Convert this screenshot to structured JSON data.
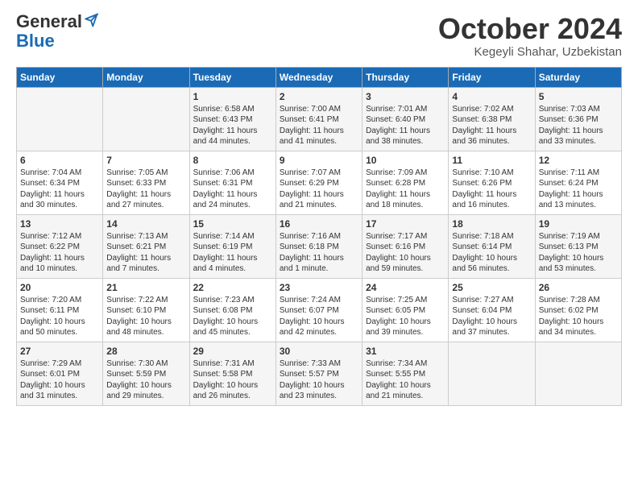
{
  "header": {
    "logo_general": "General",
    "logo_blue": "Blue",
    "month_title": "October 2024",
    "location": "Kegeyli Shahar, Uzbekistan"
  },
  "days_of_week": [
    "Sunday",
    "Monday",
    "Tuesday",
    "Wednesday",
    "Thursday",
    "Friday",
    "Saturday"
  ],
  "weeks": [
    [
      {
        "day": "",
        "content": ""
      },
      {
        "day": "",
        "content": ""
      },
      {
        "day": "1",
        "content": "Sunrise: 6:58 AM\nSunset: 6:43 PM\nDaylight: 11 hours and 44 minutes."
      },
      {
        "day": "2",
        "content": "Sunrise: 7:00 AM\nSunset: 6:41 PM\nDaylight: 11 hours and 41 minutes."
      },
      {
        "day": "3",
        "content": "Sunrise: 7:01 AM\nSunset: 6:40 PM\nDaylight: 11 hours and 38 minutes."
      },
      {
        "day": "4",
        "content": "Sunrise: 7:02 AM\nSunset: 6:38 PM\nDaylight: 11 hours and 36 minutes."
      },
      {
        "day": "5",
        "content": "Sunrise: 7:03 AM\nSunset: 6:36 PM\nDaylight: 11 hours and 33 minutes."
      }
    ],
    [
      {
        "day": "6",
        "content": "Sunrise: 7:04 AM\nSunset: 6:34 PM\nDaylight: 11 hours and 30 minutes."
      },
      {
        "day": "7",
        "content": "Sunrise: 7:05 AM\nSunset: 6:33 PM\nDaylight: 11 hours and 27 minutes."
      },
      {
        "day": "8",
        "content": "Sunrise: 7:06 AM\nSunset: 6:31 PM\nDaylight: 11 hours and 24 minutes."
      },
      {
        "day": "9",
        "content": "Sunrise: 7:07 AM\nSunset: 6:29 PM\nDaylight: 11 hours and 21 minutes."
      },
      {
        "day": "10",
        "content": "Sunrise: 7:09 AM\nSunset: 6:28 PM\nDaylight: 11 hours and 18 minutes."
      },
      {
        "day": "11",
        "content": "Sunrise: 7:10 AM\nSunset: 6:26 PM\nDaylight: 11 hours and 16 minutes."
      },
      {
        "day": "12",
        "content": "Sunrise: 7:11 AM\nSunset: 6:24 PM\nDaylight: 11 hours and 13 minutes."
      }
    ],
    [
      {
        "day": "13",
        "content": "Sunrise: 7:12 AM\nSunset: 6:22 PM\nDaylight: 11 hours and 10 minutes."
      },
      {
        "day": "14",
        "content": "Sunrise: 7:13 AM\nSunset: 6:21 PM\nDaylight: 11 hours and 7 minutes."
      },
      {
        "day": "15",
        "content": "Sunrise: 7:14 AM\nSunset: 6:19 PM\nDaylight: 11 hours and 4 minutes."
      },
      {
        "day": "16",
        "content": "Sunrise: 7:16 AM\nSunset: 6:18 PM\nDaylight: 11 hours and 1 minute."
      },
      {
        "day": "17",
        "content": "Sunrise: 7:17 AM\nSunset: 6:16 PM\nDaylight: 10 hours and 59 minutes."
      },
      {
        "day": "18",
        "content": "Sunrise: 7:18 AM\nSunset: 6:14 PM\nDaylight: 10 hours and 56 minutes."
      },
      {
        "day": "19",
        "content": "Sunrise: 7:19 AM\nSunset: 6:13 PM\nDaylight: 10 hours and 53 minutes."
      }
    ],
    [
      {
        "day": "20",
        "content": "Sunrise: 7:20 AM\nSunset: 6:11 PM\nDaylight: 10 hours and 50 minutes."
      },
      {
        "day": "21",
        "content": "Sunrise: 7:22 AM\nSunset: 6:10 PM\nDaylight: 10 hours and 48 minutes."
      },
      {
        "day": "22",
        "content": "Sunrise: 7:23 AM\nSunset: 6:08 PM\nDaylight: 10 hours and 45 minutes."
      },
      {
        "day": "23",
        "content": "Sunrise: 7:24 AM\nSunset: 6:07 PM\nDaylight: 10 hours and 42 minutes."
      },
      {
        "day": "24",
        "content": "Sunrise: 7:25 AM\nSunset: 6:05 PM\nDaylight: 10 hours and 39 minutes."
      },
      {
        "day": "25",
        "content": "Sunrise: 7:27 AM\nSunset: 6:04 PM\nDaylight: 10 hours and 37 minutes."
      },
      {
        "day": "26",
        "content": "Sunrise: 7:28 AM\nSunset: 6:02 PM\nDaylight: 10 hours and 34 minutes."
      }
    ],
    [
      {
        "day": "27",
        "content": "Sunrise: 7:29 AM\nSunset: 6:01 PM\nDaylight: 10 hours and 31 minutes."
      },
      {
        "day": "28",
        "content": "Sunrise: 7:30 AM\nSunset: 5:59 PM\nDaylight: 10 hours and 29 minutes."
      },
      {
        "day": "29",
        "content": "Sunrise: 7:31 AM\nSunset: 5:58 PM\nDaylight: 10 hours and 26 minutes."
      },
      {
        "day": "30",
        "content": "Sunrise: 7:33 AM\nSunset: 5:57 PM\nDaylight: 10 hours and 23 minutes."
      },
      {
        "day": "31",
        "content": "Sunrise: 7:34 AM\nSunset: 5:55 PM\nDaylight: 10 hours and 21 minutes."
      },
      {
        "day": "",
        "content": ""
      },
      {
        "day": "",
        "content": ""
      }
    ]
  ]
}
